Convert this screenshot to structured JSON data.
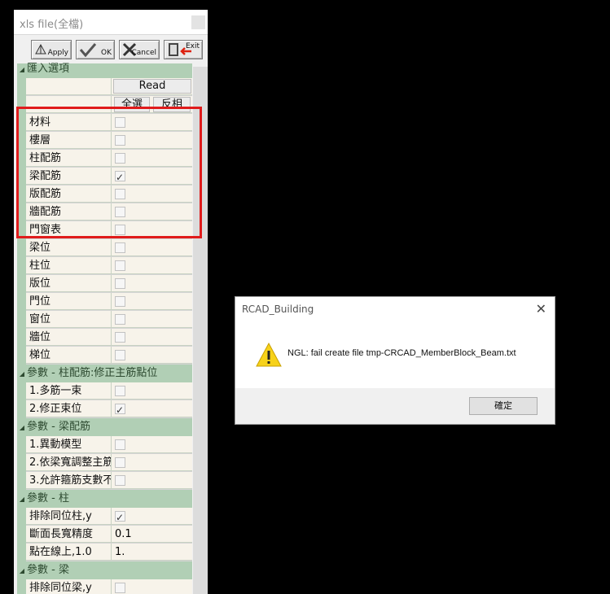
{
  "panel": {
    "title": "xls file(全檔)",
    "toolbar": {
      "apply": "Apply",
      "ok": "OK",
      "cancel": "Cancel",
      "exit": "Exit"
    },
    "grid": {
      "import_header": "匯入選項",
      "read_button": "Read",
      "select_all": "全選",
      "invert": "反相",
      "import_items": [
        {
          "label": "材料",
          "checked": false
        },
        {
          "label": "樓層",
          "checked": false
        },
        {
          "label": "柱配筋",
          "checked": false
        },
        {
          "label": "梁配筋",
          "checked": true
        },
        {
          "label": "版配筋",
          "checked": false
        },
        {
          "label": "牆配筋",
          "checked": false
        },
        {
          "label": "門窗表",
          "checked": false
        },
        {
          "label": "梁位",
          "checked": false
        },
        {
          "label": "柱位",
          "checked": false
        },
        {
          "label": "版位",
          "checked": false
        },
        {
          "label": "門位",
          "checked": false
        },
        {
          "label": "窗位",
          "checked": false
        },
        {
          "label": "牆位",
          "checked": false
        },
        {
          "label": "梯位",
          "checked": false
        }
      ],
      "cat_col": "參數 - 柱配筋:修正主筋點位",
      "col_items": [
        {
          "label": "1.多筋一束",
          "checked": false
        },
        {
          "label": "2.修正束位",
          "checked": true
        }
      ],
      "cat_beam": "參數 - 梁配筋",
      "beam_items": [
        {
          "label": "1.異動模型",
          "checked": false
        },
        {
          "label": "2.依梁寬調整主筋",
          "checked": false
        },
        {
          "label": "3.允許箍筋支數不",
          "checked": false
        }
      ],
      "cat_column": "參數 - 柱",
      "column_items": [
        {
          "label": "排除同位柱,y",
          "type": "check",
          "checked": true
        },
        {
          "label": "斷面長寬精度",
          "type": "text",
          "value": "0.1"
        },
        {
          "label": "點在線上,1.0",
          "type": "text",
          "value": "1."
        }
      ],
      "cat_beam2": "參數 - 梁",
      "beam2_items": [
        {
          "label": "排除同位梁,y",
          "checked": false
        }
      ]
    }
  },
  "dialog": {
    "title": "RCAD_Building",
    "message": "NGL: fail create file tmp-CRCAD_MemberBlock_Beam.txt",
    "ok_label": "確定",
    "close_glyph": "✕"
  },
  "colors": {
    "highlight": "#e01b1b",
    "category": "#b1cfb5",
    "cell": "#f7f3ea"
  }
}
